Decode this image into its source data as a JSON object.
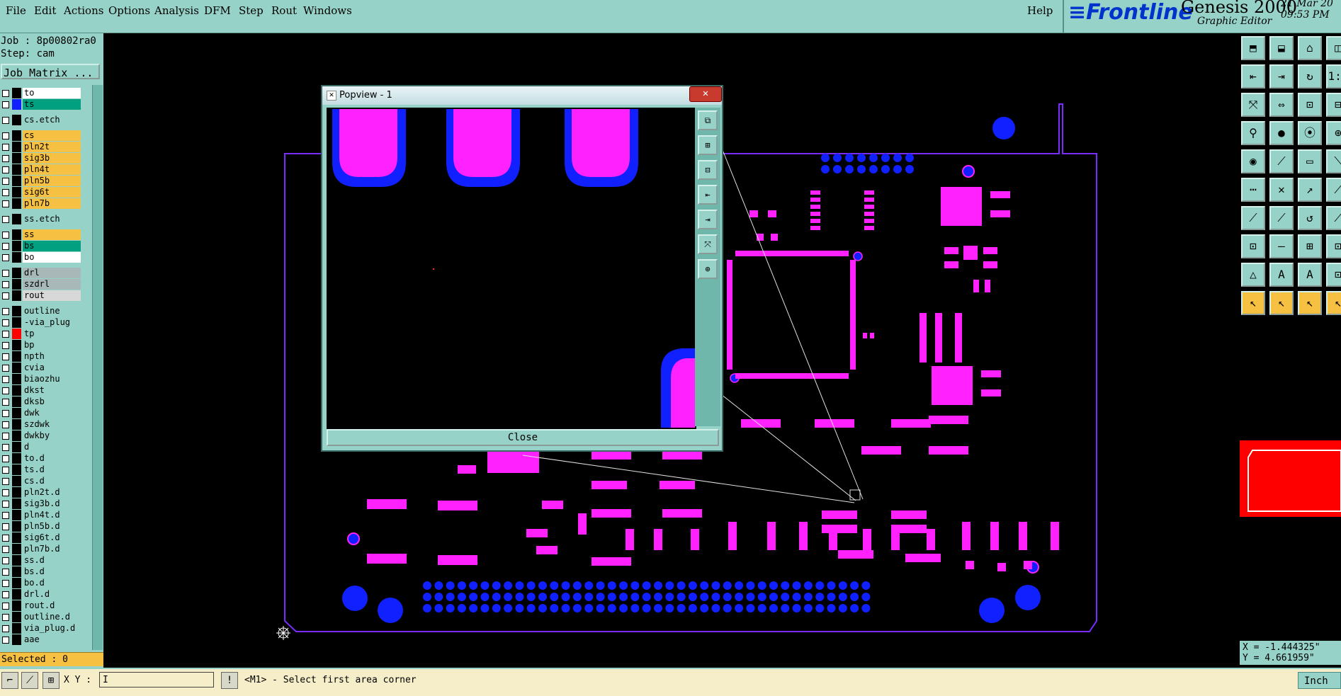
{
  "menu": {
    "items": [
      "File",
      "Edit",
      "Actions",
      "Options",
      "Analysis",
      "DFM",
      "Step",
      "Rout",
      "Windows"
    ],
    "help": "Help"
  },
  "brand": {
    "logo": "≡Frontline",
    "product": "Genesis 2000",
    "subtitle": "Graphic Editor",
    "date_line1": "21 Mar 20",
    "date_line2": "09:53 PM"
  },
  "job": {
    "job_line": "Job : 8p00802ra0",
    "step_line": "Step: cam",
    "matrix_button": "Job Matrix ..."
  },
  "layers": [
    {
      "name": "to",
      "color": "#ffffff",
      "swatch": "#000000"
    },
    {
      "name": "ts",
      "color": "#00a080",
      "swatch": "#1020ff"
    },
    {
      "name": "cs.etch",
      "color": "#96d2c8",
      "swatch": "#000000"
    },
    {
      "name": "cs",
      "color": "#f6c142",
      "swatch": "#000000"
    },
    {
      "name": "pln2t",
      "color": "#f6c142",
      "swatch": "#000000"
    },
    {
      "name": "sig3b",
      "color": "#f6c142",
      "swatch": "#000000"
    },
    {
      "name": "pln4t",
      "color": "#f6c142",
      "swatch": "#000000"
    },
    {
      "name": "pln5b",
      "color": "#f6c142",
      "swatch": "#000000"
    },
    {
      "name": "sig6t",
      "color": "#f6c142",
      "swatch": "#000000"
    },
    {
      "name": "pln7b",
      "color": "#f6c142",
      "swatch": "#000000"
    },
    {
      "name": "ss.etch",
      "color": "#96d2c8",
      "swatch": "#000000"
    },
    {
      "name": "ss",
      "color": "#f6c142",
      "swatch": "#000000"
    },
    {
      "name": "bs",
      "color": "#00a080",
      "swatch": "#000000"
    },
    {
      "name": "bo",
      "color": "#ffffff",
      "swatch": "#000000"
    },
    {
      "name": "drl",
      "color": "#a8b8b8",
      "swatch": "#000000"
    },
    {
      "name": "szdrl",
      "color": "#a8b8b8",
      "swatch": "#000000"
    },
    {
      "name": "rout",
      "color": "#d8d8d8",
      "swatch": "#000000"
    },
    {
      "name": "outline",
      "color": "#96d2c8",
      "swatch": "#000000"
    },
    {
      "name": "-via_plug",
      "color": "#96d2c8",
      "swatch": "#000000"
    },
    {
      "name": "tp",
      "color": "#96d2c8",
      "swatch": "#ff0000"
    },
    {
      "name": "bp",
      "color": "#96d2c8",
      "swatch": "#000000"
    },
    {
      "name": "npth",
      "color": "#96d2c8",
      "swatch": "#000000"
    },
    {
      "name": "cvia",
      "color": "#96d2c8",
      "swatch": "#000000"
    },
    {
      "name": "biaozhu",
      "color": "#96d2c8",
      "swatch": "#000000"
    },
    {
      "name": "dkst",
      "color": "#96d2c8",
      "swatch": "#000000"
    },
    {
      "name": "dksb",
      "color": "#96d2c8",
      "swatch": "#000000"
    },
    {
      "name": "dwk",
      "color": "#96d2c8",
      "swatch": "#000000"
    },
    {
      "name": "szdwk",
      "color": "#96d2c8",
      "swatch": "#000000"
    },
    {
      "name": "dwkby",
      "color": "#96d2c8",
      "swatch": "#000000"
    },
    {
      "name": "d",
      "color": "#96d2c8",
      "swatch": "#000000"
    },
    {
      "name": "to.d",
      "color": "#96d2c8",
      "swatch": "#000000"
    },
    {
      "name": "ts.d",
      "color": "#96d2c8",
      "swatch": "#000000"
    },
    {
      "name": "cs.d",
      "color": "#96d2c8",
      "swatch": "#000000"
    },
    {
      "name": "pln2t.d",
      "color": "#96d2c8",
      "swatch": "#000000"
    },
    {
      "name": "sig3b.d",
      "color": "#96d2c8",
      "swatch": "#000000"
    },
    {
      "name": "pln4t.d",
      "color": "#96d2c8",
      "swatch": "#000000"
    },
    {
      "name": "pln5b.d",
      "color": "#96d2c8",
      "swatch": "#000000"
    },
    {
      "name": "sig6t.d",
      "color": "#96d2c8",
      "swatch": "#000000"
    },
    {
      "name": "pln7b.d",
      "color": "#96d2c8",
      "swatch": "#000000"
    },
    {
      "name": "ss.d",
      "color": "#96d2c8",
      "swatch": "#000000"
    },
    {
      "name": "bs.d",
      "color": "#96d2c8",
      "swatch": "#000000"
    },
    {
      "name": "bo.d",
      "color": "#96d2c8",
      "swatch": "#000000"
    },
    {
      "name": "drl.d",
      "color": "#96d2c8",
      "swatch": "#000000"
    },
    {
      "name": "rout.d",
      "color": "#96d2c8",
      "swatch": "#000000"
    },
    {
      "name": "outline.d",
      "color": "#96d2c8",
      "swatch": "#000000"
    },
    {
      "name": "via_plug.d",
      "color": "#96d2c8",
      "swatch": "#000000"
    },
    {
      "name": "aae",
      "color": "#96d2c8",
      "swatch": "#000000"
    }
  ],
  "status": {
    "selected": "Selected : 0",
    "xy_label": "X Y :",
    "xy_value": "I",
    "prompt": "<M1> - Select first area corner",
    "unit": "Inch"
  },
  "coords": {
    "x": "X = -1.444325\"",
    "y": "Y = 4.661959\""
  },
  "popview": {
    "title": "Popview - 1",
    "close_button": "Close"
  },
  "colors": {
    "panel": "#96d2c8",
    "pad": "#ff22ff",
    "mask": "#1020ff",
    "outline": "#7a2cff"
  }
}
